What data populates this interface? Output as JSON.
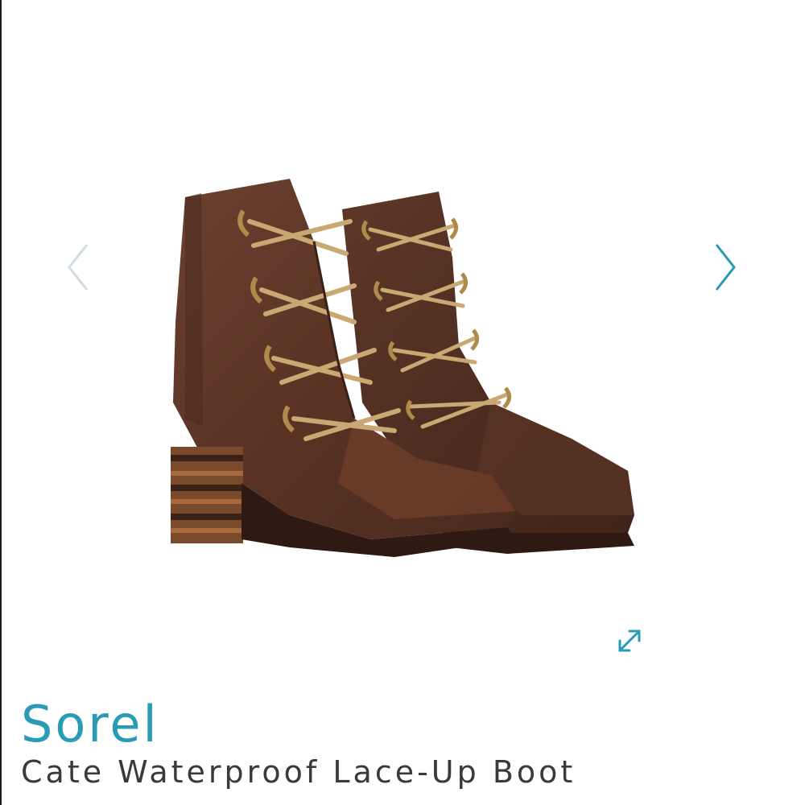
{
  "colors": {
    "accent": "#2a9bb5",
    "arrow_inactive": "#c9d6dc",
    "text": "#3a3a3a"
  },
  "gallery": {
    "prev_icon": "chevron-left-icon",
    "next_icon": "chevron-right-icon",
    "expand_icon": "expand-arrows-icon",
    "image_subject": "pair of brown leather lace-up heeled boots"
  },
  "product": {
    "brand": "Sorel",
    "name": "Cate Waterproof Lace-Up Boot"
  }
}
